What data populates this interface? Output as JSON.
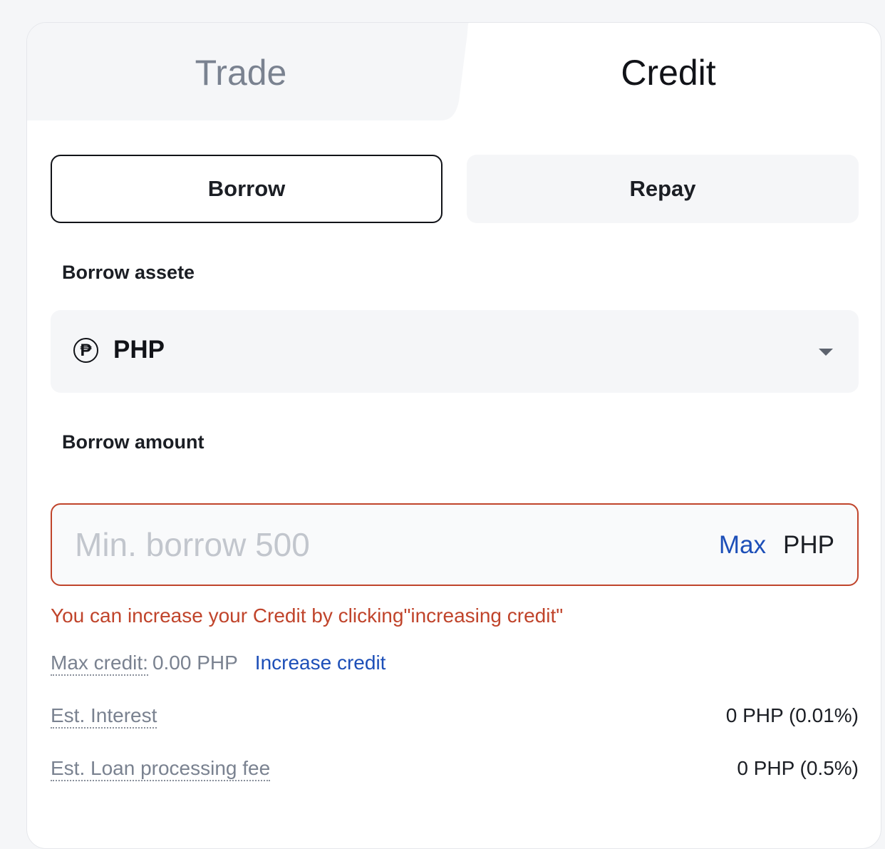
{
  "tabs": {
    "trade": "Trade",
    "credit": "Credit"
  },
  "segment": {
    "borrow": "Borrow",
    "repay": "Repay"
  },
  "borrow_asset": {
    "label": "Borrow assete",
    "coin_symbol": "₱",
    "coin_icon": "peso-coin-icon",
    "value": "PHP"
  },
  "borrow_amount": {
    "label": "Borrow amount",
    "placeholder": "Min. borrow 500",
    "value": "",
    "max_label": "Max",
    "unit": "PHP"
  },
  "error_text": "You can increase your Credit by clicking\"increasing credit\"",
  "max_credit": {
    "label": "Max credit:",
    "value": "0.00 PHP",
    "link": "Increase credit"
  },
  "est_interest": {
    "label": "Est. Interest",
    "value": "0 PHP (0.01%)"
  },
  "est_fee": {
    "label": "Est. Loan processing fee",
    "value": "0 PHP (0.5%)"
  },
  "colors": {
    "error": "#c0442b",
    "link": "#1d4fb8"
  }
}
